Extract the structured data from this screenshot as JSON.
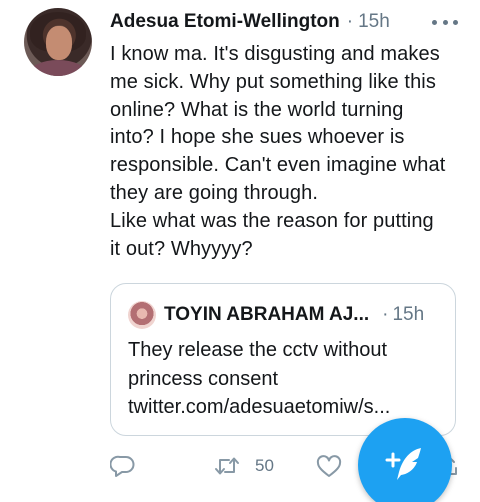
{
  "tweet": {
    "author_name": "Adesua Etomi-Wellington",
    "separator": "·",
    "time": "15h",
    "more_icon": "more-horizontal-icon",
    "body_lines": [
      "I know ma. It's disgusting and makes",
      "me sick. Why put something like this",
      "online? What is the world turning",
      "into? I hope she sues whoever is",
      "responsible. Can't even imagine what",
      "they are going through.",
      "Like what was the reason for putting",
      "it out? Whyyyy?"
    ]
  },
  "quote": {
    "author_name": "TOYIN ABRAHAM AJ...",
    "separator": "·",
    "time": "15h",
    "text_lines": [
      "They release the cctv without",
      "princess consent",
      "twitter.com/adesuaetomiw/s..."
    ]
  },
  "actions": {
    "reply_icon": "reply-icon",
    "retweet_icon": "retweet-icon",
    "retweet_count": "50",
    "like_icon": "heart-icon",
    "share_icon": "share-icon"
  },
  "fab": {
    "icon": "compose-tweet-icon",
    "color": "#1da1f2"
  },
  "colors": {
    "text": "#14171a",
    "secondary": "#657786",
    "border": "#ccd6dd",
    "accent": "#1da1f2"
  }
}
